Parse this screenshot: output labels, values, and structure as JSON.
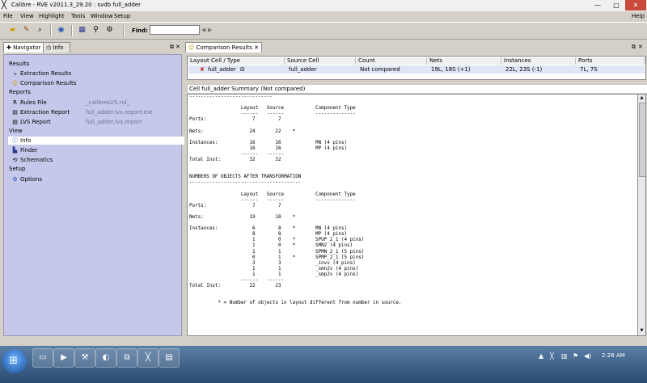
{
  "window": {
    "title": "Calibre - RVE v2011.3_29.20 : svdb full_adder",
    "minimize": "—",
    "maximize": "□",
    "close": "✕"
  },
  "menu": {
    "file": "File",
    "view": "View",
    "highlight": "Highlight",
    "tools": "Tools",
    "window": "Window",
    "setup": "Setup",
    "help": "Help"
  },
  "toolbar": {
    "find_label": "Find:",
    "find_value": ""
  },
  "left_pane": {
    "tab_navigator": "Navigator",
    "tab_info": "Info",
    "sections": {
      "results": "Results",
      "reports": "Reports",
      "view": "View",
      "setup": "Setup"
    },
    "items": {
      "extraction_results": "Extraction Results",
      "comparison_results": "Comparison Results",
      "rules_file": "Rules File",
      "rules_file_sub": "_calibreLVS.rul_",
      "extraction_report": "Extraction Report",
      "extraction_report_sub": "full_adder.lvs.report.ext",
      "lvs_report": "LVS Report",
      "lvs_report_sub": "full_adder.lvs.report",
      "info": "Info",
      "finder": "Finder",
      "schematics": "Schematics",
      "options": "Options"
    }
  },
  "right_pane": {
    "tab_title": "Comparison Results",
    "table": {
      "headers": [
        "Layout Cell / Type",
        "Source Cell",
        "Count",
        "Nets",
        "Instances",
        "Ports"
      ],
      "row": [
        "full_adder",
        "full_adder",
        "Not compared",
        "19L, 18S (+1)",
        "22L, 23S (-1)",
        "7L, 7S"
      ]
    },
    "report_header": "Cell full_adder Summary (Not compared)",
    "report_text": "-----------------------------\n\n                  Layout   Source           Component Type\n                  ------   ------           --------------\nPorts:                7        7\n\nNets:                24       22    *\n\nInstances:           16       16            MN (4 pins)\n                     16       16            MP (4 pins)\n                  ------   ------\nTotal Inst:          32       32\n\n\nNUMBERS OF OBJECTS AFTER TRANSFORMATION\n---------------------------------------\n\n                  Layout   Source           Component Type\n                  ------   ------           --------------\nPorts:                7        7\n\nNets:                19       18    *\n\nInstances:            6        8    *       MN (4 pins)\n                      8        8            MP (4 pins)\n                      1        0    *       SPUP_2_1 (4 pins)\n                      1        0    *       SMN2 (4 pins)\n                      1        1            SPMN_2_1 (5 pins)\n                      0        1    *       SPMP_2_1 (5 pins)\n                      3        3            _invv (4 pins)\n                      1        1            _smn2v (4 pins)\n                      1        1            _smp2v (4 pins)\n                  ------   ------\nTotal Inst:          22       23\n\n\n          * = Number of objects in layout different from number in source."
  },
  "taskbar": {
    "clock": "2:28 AM"
  }
}
